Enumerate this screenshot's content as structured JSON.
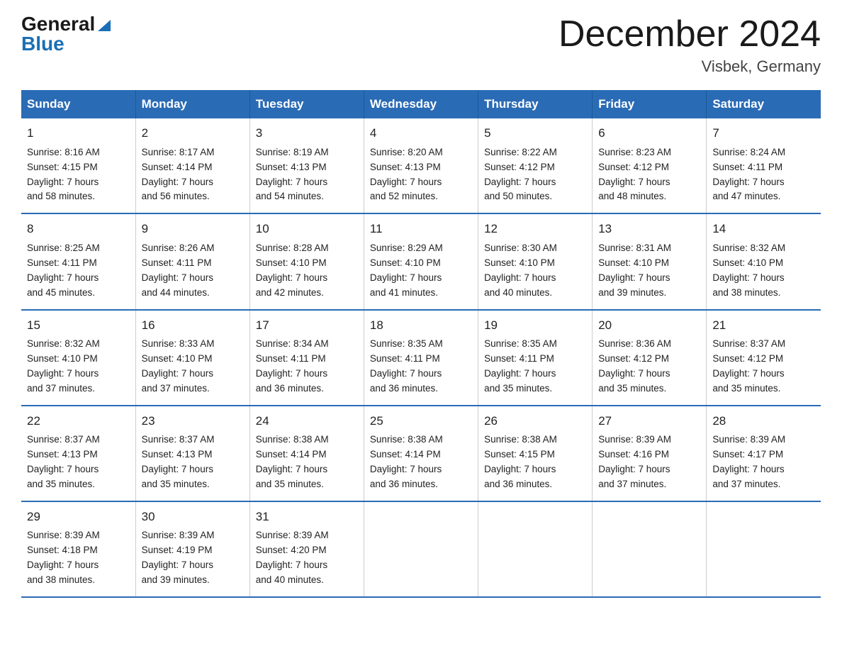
{
  "logo": {
    "general": "General",
    "blue": "Blue"
  },
  "title": "December 2024",
  "location": "Visbek, Germany",
  "days_of_week": [
    "Sunday",
    "Monday",
    "Tuesday",
    "Wednesday",
    "Thursday",
    "Friday",
    "Saturday"
  ],
  "weeks": [
    [
      {
        "day": "1",
        "sunrise": "8:16 AM",
        "sunset": "4:15 PM",
        "daylight": "7 hours and 58 minutes."
      },
      {
        "day": "2",
        "sunrise": "8:17 AM",
        "sunset": "4:14 PM",
        "daylight": "7 hours and 56 minutes."
      },
      {
        "day": "3",
        "sunrise": "8:19 AM",
        "sunset": "4:13 PM",
        "daylight": "7 hours and 54 minutes."
      },
      {
        "day": "4",
        "sunrise": "8:20 AM",
        "sunset": "4:13 PM",
        "daylight": "7 hours and 52 minutes."
      },
      {
        "day": "5",
        "sunrise": "8:22 AM",
        "sunset": "4:12 PM",
        "daylight": "7 hours and 50 minutes."
      },
      {
        "day": "6",
        "sunrise": "8:23 AM",
        "sunset": "4:12 PM",
        "daylight": "7 hours and 48 minutes."
      },
      {
        "day": "7",
        "sunrise": "8:24 AM",
        "sunset": "4:11 PM",
        "daylight": "7 hours and 47 minutes."
      }
    ],
    [
      {
        "day": "8",
        "sunrise": "8:25 AM",
        "sunset": "4:11 PM",
        "daylight": "7 hours and 45 minutes."
      },
      {
        "day": "9",
        "sunrise": "8:26 AM",
        "sunset": "4:11 PM",
        "daylight": "7 hours and 44 minutes."
      },
      {
        "day": "10",
        "sunrise": "8:28 AM",
        "sunset": "4:10 PM",
        "daylight": "7 hours and 42 minutes."
      },
      {
        "day": "11",
        "sunrise": "8:29 AM",
        "sunset": "4:10 PM",
        "daylight": "7 hours and 41 minutes."
      },
      {
        "day": "12",
        "sunrise": "8:30 AM",
        "sunset": "4:10 PM",
        "daylight": "7 hours and 40 minutes."
      },
      {
        "day": "13",
        "sunrise": "8:31 AM",
        "sunset": "4:10 PM",
        "daylight": "7 hours and 39 minutes."
      },
      {
        "day": "14",
        "sunrise": "8:32 AM",
        "sunset": "4:10 PM",
        "daylight": "7 hours and 38 minutes."
      }
    ],
    [
      {
        "day": "15",
        "sunrise": "8:32 AM",
        "sunset": "4:10 PM",
        "daylight": "7 hours and 37 minutes."
      },
      {
        "day": "16",
        "sunrise": "8:33 AM",
        "sunset": "4:10 PM",
        "daylight": "7 hours and 37 minutes."
      },
      {
        "day": "17",
        "sunrise": "8:34 AM",
        "sunset": "4:11 PM",
        "daylight": "7 hours and 36 minutes."
      },
      {
        "day": "18",
        "sunrise": "8:35 AM",
        "sunset": "4:11 PM",
        "daylight": "7 hours and 36 minutes."
      },
      {
        "day": "19",
        "sunrise": "8:35 AM",
        "sunset": "4:11 PM",
        "daylight": "7 hours and 35 minutes."
      },
      {
        "day": "20",
        "sunrise": "8:36 AM",
        "sunset": "4:12 PM",
        "daylight": "7 hours and 35 minutes."
      },
      {
        "day": "21",
        "sunrise": "8:37 AM",
        "sunset": "4:12 PM",
        "daylight": "7 hours and 35 minutes."
      }
    ],
    [
      {
        "day": "22",
        "sunrise": "8:37 AM",
        "sunset": "4:13 PM",
        "daylight": "7 hours and 35 minutes."
      },
      {
        "day": "23",
        "sunrise": "8:37 AM",
        "sunset": "4:13 PM",
        "daylight": "7 hours and 35 minutes."
      },
      {
        "day": "24",
        "sunrise": "8:38 AM",
        "sunset": "4:14 PM",
        "daylight": "7 hours and 35 minutes."
      },
      {
        "day": "25",
        "sunrise": "8:38 AM",
        "sunset": "4:14 PM",
        "daylight": "7 hours and 36 minutes."
      },
      {
        "day": "26",
        "sunrise": "8:38 AM",
        "sunset": "4:15 PM",
        "daylight": "7 hours and 36 minutes."
      },
      {
        "day": "27",
        "sunrise": "8:39 AM",
        "sunset": "4:16 PM",
        "daylight": "7 hours and 37 minutes."
      },
      {
        "day": "28",
        "sunrise": "8:39 AM",
        "sunset": "4:17 PM",
        "daylight": "7 hours and 37 minutes."
      }
    ],
    [
      {
        "day": "29",
        "sunrise": "8:39 AM",
        "sunset": "4:18 PM",
        "daylight": "7 hours and 38 minutes."
      },
      {
        "day": "30",
        "sunrise": "8:39 AM",
        "sunset": "4:19 PM",
        "daylight": "7 hours and 39 minutes."
      },
      {
        "day": "31",
        "sunrise": "8:39 AM",
        "sunset": "4:20 PM",
        "daylight": "7 hours and 40 minutes."
      },
      null,
      null,
      null,
      null
    ]
  ],
  "labels": {
    "sunrise": "Sunrise:",
    "sunset": "Sunset:",
    "daylight": "Daylight:"
  }
}
